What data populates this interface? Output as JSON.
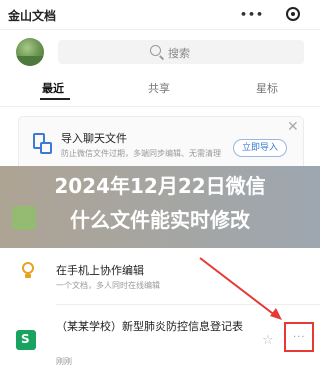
{
  "app": {
    "title": "金山文档",
    "menu_dots": "•••"
  },
  "search": {
    "placeholder": "搜索"
  },
  "tabs": [
    {
      "label": "最近",
      "active": true
    },
    {
      "label": "共享",
      "active": false
    },
    {
      "label": "星标",
      "active": false
    }
  ],
  "banner": {
    "title": "导入聊天文件",
    "subtitle": "防止微信文件过期，多端同步编辑、无需清理",
    "button_label": "立即导入",
    "close_symbol": "✕"
  },
  "headline": {
    "line1": "2024年12月22日微信",
    "line2": "什么文件能实时修改"
  },
  "files": [
    {
      "title": "在手机上协作编辑",
      "subtitle": "一个文档，多人同时在线编辑",
      "icon": "bulb-icon"
    },
    {
      "title": "（某某学校）新型肺炎防控信息登记表",
      "subtitle": "刚刚",
      "icon": "sheet-icon",
      "star": "☆",
      "more": "···"
    }
  ],
  "colors": {
    "accent": "#3a7bd5",
    "sheet": "#1aa260",
    "highlight": "#e53935",
    "bulb": "#e8a21e"
  }
}
